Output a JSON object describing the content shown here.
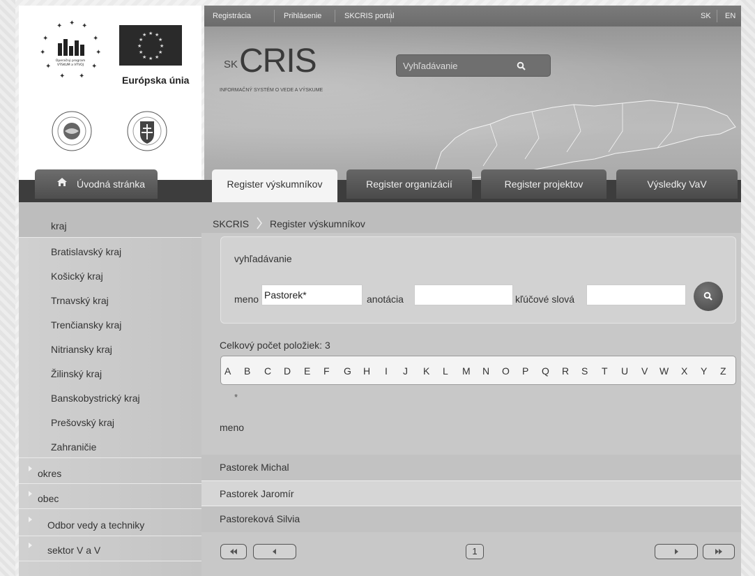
{
  "topbar": {
    "links": [
      "Registrácia",
      "Prihlásenie",
      "SKCRIS portál"
    ],
    "languages": [
      "SK",
      "EN"
    ]
  },
  "logos": {
    "eu_label": "Európska únia",
    "op_text": [
      "Operačný program",
      "VÝSKUM a VÝVOJ"
    ]
  },
  "brand": {
    "sk": "SK",
    "cris": "CRIS",
    "subtitle": "INFORMAČNÝ SYSTÉM O VEDE A VÝSKUME"
  },
  "header_search": {
    "placeholder": "Vyhľadávanie",
    "icon": "search-icon"
  },
  "nav": {
    "home": "Úvodná stránka",
    "tabs": [
      "Register výskumníkov",
      "Register organizácií",
      "Register projektov",
      "Výsledky VaV"
    ],
    "active_tab": "Register výskumníkov"
  },
  "sidebar": {
    "heading": "kraj",
    "regions": [
      "Bratislavský kraj",
      "Košický kraj",
      "Trnavský kraj",
      "Trenčiansky kraj",
      "Nitriansky kraj",
      "Žilinský kraj",
      "Banskobystrický kraj",
      "Prešovský kraj",
      "Zahraničie"
    ],
    "groups": [
      "okres",
      "obec",
      "Odbor vedy a techniky",
      "sektor V a V"
    ]
  },
  "breadcrumb": [
    "SKCRIS",
    "Register výskumníkov"
  ],
  "search": {
    "title": "vyhľadávanie",
    "name_label": "meno",
    "name_value": "Pastorek*",
    "annotation_label": "anotácia",
    "annotation_value": "",
    "keywords_label": "kľúčové slová",
    "keywords_value": ""
  },
  "results": {
    "count_text": "Celkový počet položiek: 3",
    "alphabet": [
      "A",
      "B",
      "C",
      "D",
      "E",
      "F",
      "G",
      "H",
      "I",
      "J",
      "K",
      "L",
      "M",
      "N",
      "O",
      "P",
      "Q",
      "R",
      "S",
      "T",
      "U",
      "V",
      "W",
      "X",
      "Y",
      "Z"
    ],
    "wildcard": "*",
    "column_header": "meno",
    "rows": [
      "Pastorek Michal",
      "Pastorek Jaromír",
      "Pastoreková Silvia"
    ]
  },
  "pager": {
    "current_page": "1"
  },
  "colors": {
    "dark_tab": "#4a4a4a",
    "active_tab": "#f4f4f4",
    "sidebar": "#c8c8c8"
  }
}
